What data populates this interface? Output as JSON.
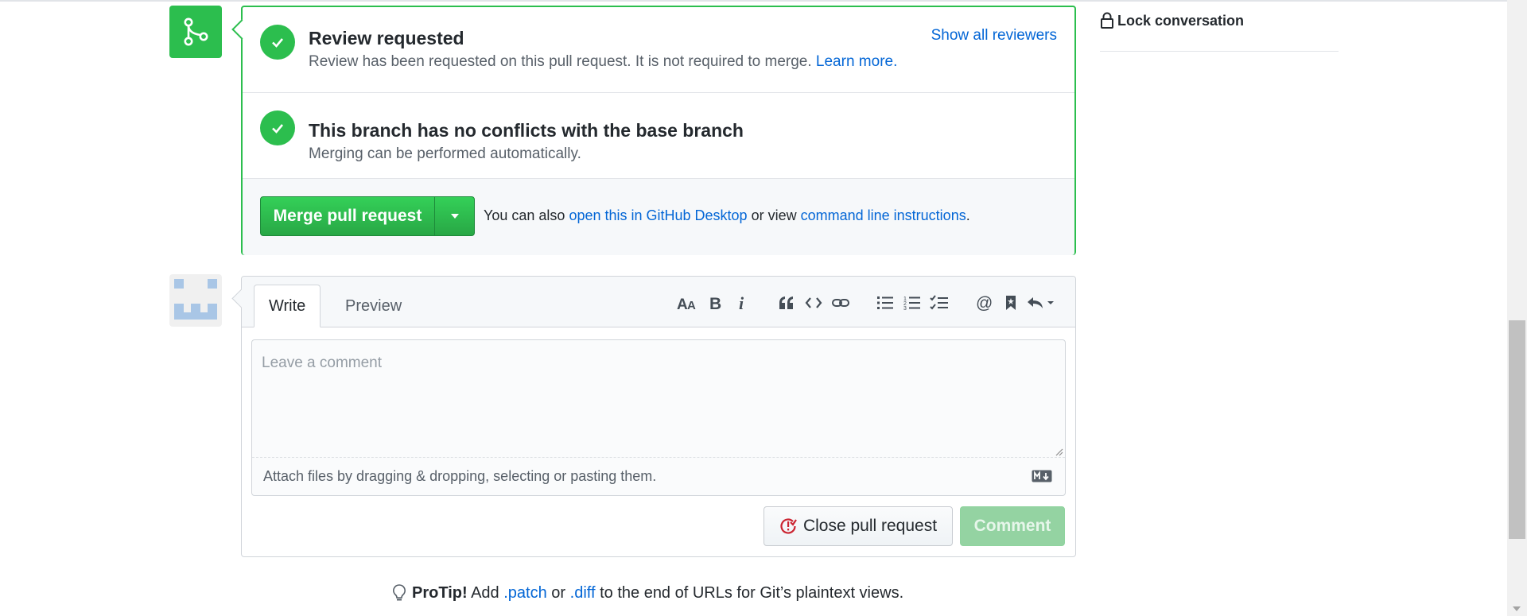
{
  "merge_box": {
    "review": {
      "title": "Review requested",
      "description": "Review has been requested on this pull request. It is not required to merge.",
      "learn_more": "Learn more.",
      "show_all_reviewers": "Show all reviewers"
    },
    "conflicts": {
      "title": "This branch has no conflicts with the base branch",
      "description": "Merging can be performed automatically."
    },
    "merge_button": "Merge pull request",
    "alt_prefix": "You can also",
    "alt_desktop_link": "open this in GitHub Desktop",
    "alt_middle": "or view",
    "alt_cli_link": "command line instructions",
    "alt_suffix": "."
  },
  "comment": {
    "tabs": {
      "write": "Write",
      "preview": "Preview"
    },
    "toolbar_icons": [
      "text-size-icon",
      "bold-icon",
      "italic-icon",
      "quote-icon",
      "code-icon",
      "link-icon",
      "bulleted-list-icon",
      "numbered-list-icon",
      "task-list-icon",
      "mention-icon",
      "saved-reply-icon",
      "reply-icon"
    ],
    "placeholder": "Leave a comment",
    "attach_text": "Attach files by dragging & dropping, selecting or pasting them.",
    "close_button": "Close pull request",
    "comment_button": "Comment"
  },
  "protip": {
    "label": "ProTip!",
    "text_add": "Add",
    "patch": ".patch",
    "or": "or",
    "diff": ".diff",
    "rest": "to the end of URLs for Git’s plaintext views."
  },
  "sidebar": {
    "lock_conversation": "Lock conversation"
  },
  "colors": {
    "success": "#2cbe4e",
    "link": "#0366d6",
    "danger": "#cb2431"
  }
}
